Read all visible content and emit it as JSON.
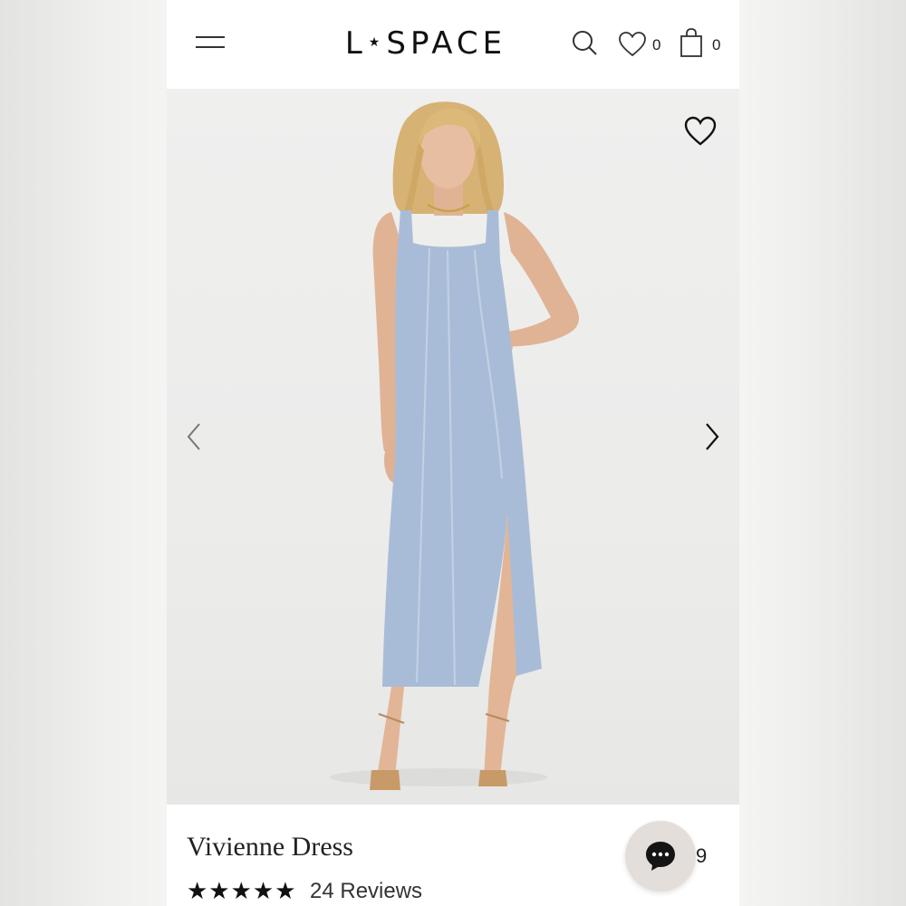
{
  "header": {
    "brand_left": "L",
    "brand_star": "★",
    "brand_right": "SPACE",
    "wishlist_count": "0",
    "cart_count": "0",
    "icons": [
      "menu-icon",
      "search-icon",
      "heart-icon",
      "bag-icon"
    ]
  },
  "gallery": {
    "icons": [
      "heart-icon",
      "chevron-left-icon",
      "chevron-right-icon"
    ],
    "image_subject": "model in light blue midi dress"
  },
  "product": {
    "name": "Vivienne Dress",
    "stars": "★★★★★",
    "rating_value": 5,
    "reviews": "24 Reviews",
    "price_fragment": "9"
  },
  "chat": {
    "icon": "chat-bubble-icon"
  },
  "colors": {
    "dress": "#a9bcd7",
    "skin": "#e3b89c",
    "hair": "#d9b774",
    "chat_bg": "#e4dedb"
  }
}
